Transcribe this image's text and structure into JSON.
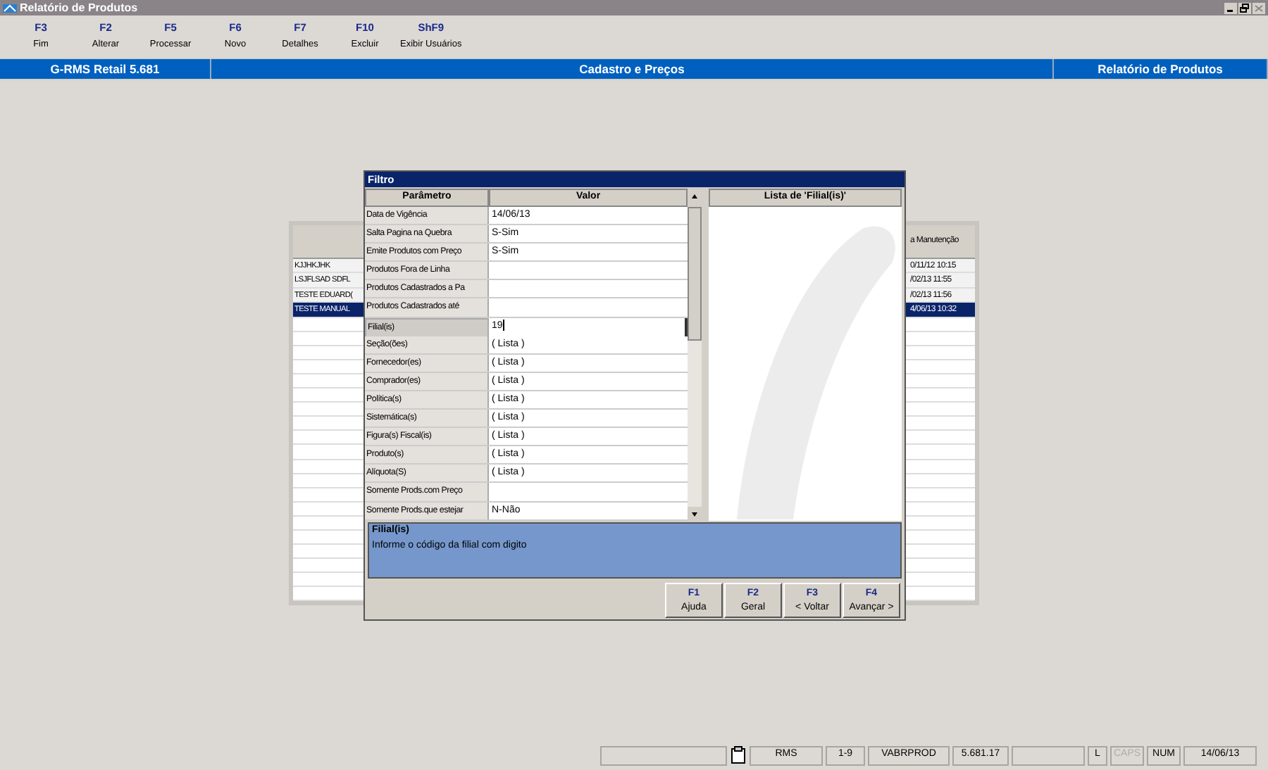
{
  "window": {
    "title": "Relatório de Produtos"
  },
  "toolbar": [
    {
      "key": "F3",
      "label": "Fim"
    },
    {
      "key": "F2",
      "label": "Alterar"
    },
    {
      "key": "F5",
      "label": "Processar"
    },
    {
      "key": "F6",
      "label": "Novo"
    },
    {
      "key": "F7",
      "label": "Detalhes"
    },
    {
      "key": "F10",
      "label": "Excluir"
    },
    {
      "key": "ShF9",
      "label": "Exibir Usuários"
    }
  ],
  "header_bar": [
    "G-RMS Retail 5.681",
    "Cadastro e Preços",
    "Relatório de Produtos"
  ],
  "background_table": {
    "column_3": "a Manutenção",
    "rows": [
      {
        "column_1": "KJJHKJHK",
        "column_3": "0/11/12 10:15",
        "selected": false
      },
      {
        "column_1": "LSJFLSAD SDFL",
        "column_3": "/02/13 11:55",
        "selected": false
      },
      {
        "column_1": "TESTE EDUARD(",
        "column_3": "/02/13 11:56",
        "selected": false
      },
      {
        "column_1": "TESTE MANUAL",
        "column_3": "4/06/13 10:32",
        "selected": true
      }
    ]
  },
  "dialog": {
    "title": "Filtro",
    "columns": [
      "Parâmetro",
      "Valor"
    ],
    "params": [
      {
        "name": "Data de Vigência",
        "value": "14/06/13",
        "selected": false
      },
      {
        "name": "Salta Pagina na Quebra",
        "value": "S-Sim",
        "selected": false
      },
      {
        "name": "Emite Produtos com Preço",
        "value": "S-Sim",
        "selected": false
      },
      {
        "name": "Produtos Fora de Linha",
        "selected": false
      },
      {
        "name": "Produtos Cadastrados a Pa",
        "selected": false
      },
      {
        "name": "Produtos Cadastrados até",
        "selected": false
      },
      {
        "name": "Filial(is)",
        "value": "19",
        "selected": true
      },
      {
        "name": "Seção(ões)",
        "value": "( Lista )",
        "selected": false
      },
      {
        "name": "Fornecedor(es)",
        "value": "( Lista )",
        "selected": false
      },
      {
        "name": "Comprador(es)",
        "value": "( Lista )",
        "selected": false
      },
      {
        "name": "Política(s)",
        "value": "( Lista )",
        "selected": false
      },
      {
        "name": "Sistemática(s)",
        "value": "( Lista )",
        "selected": false
      },
      {
        "name": "Figura(s) Fiscal(is)",
        "value": "( Lista )",
        "selected": false
      },
      {
        "name": "Produto(s)",
        "value": "( Lista )",
        "selected": false
      },
      {
        "name": "Alíquota(S)",
        "value": "( Lista )",
        "selected": false
      },
      {
        "name": "Somente Prods.com Preço",
        "selected": false
      },
      {
        "name": "Somente Prods.que estejar",
        "value": "N-Não",
        "selected": false
      }
    ],
    "list_title": "Lista de 'Filial(is)'",
    "help": {
      "title": "Filial(is)",
      "text": "Informe o código da filial com digito"
    },
    "buttons": [
      {
        "key": "F1",
        "label": "Ajuda"
      },
      {
        "key": "F2",
        "label": "Geral"
      },
      {
        "key": "F3",
        "label": "< Voltar"
      },
      {
        "key": "F4",
        "label": "Avançar >"
      }
    ]
  },
  "status_bar": [
    {
      "kind": "blank"
    },
    {
      "kind": "icon"
    },
    {
      "kind": "text",
      "text": "RMS",
      "disabled": false
    },
    {
      "kind": "text",
      "text": "1-9",
      "disabled": false
    },
    {
      "kind": "text",
      "text": "VABRPROD",
      "disabled": false
    },
    {
      "kind": "text",
      "text": "5.681.17",
      "disabled": false
    },
    {
      "kind": "blank"
    },
    {
      "kind": "text",
      "text": "L",
      "disabled": false
    },
    {
      "kind": "text",
      "text": "CAPS",
      "disabled": true
    },
    {
      "kind": "text",
      "text": "NUM",
      "disabled": false
    },
    {
      "kind": "text",
      "text": "14/06/13",
      "disabled": false
    }
  ]
}
